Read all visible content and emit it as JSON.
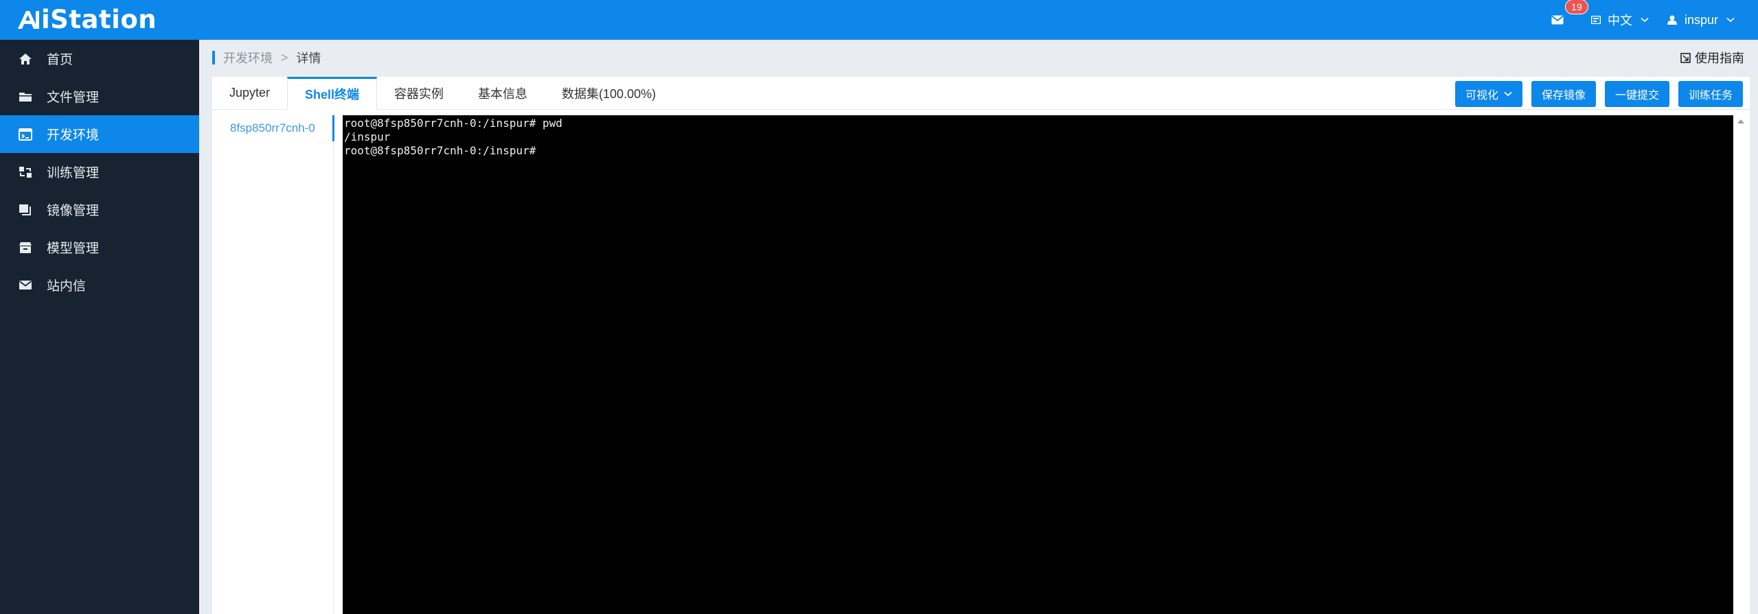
{
  "app": {
    "logo_text": "iStation",
    "logo_mark": "AI"
  },
  "header": {
    "unread_count": "19",
    "language": "中文",
    "username": "inspur"
  },
  "sidebar": {
    "items": [
      {
        "label": "首页",
        "icon": "home-icon"
      },
      {
        "label": "文件管理",
        "icon": "folder-icon"
      },
      {
        "label": "开发环境",
        "icon": "dev-env-icon",
        "active": true
      },
      {
        "label": "训练管理",
        "icon": "training-icon"
      },
      {
        "label": "镜像管理",
        "icon": "image-stack-icon"
      },
      {
        "label": "模型管理",
        "icon": "model-box-icon"
      },
      {
        "label": "站内信",
        "icon": "mail-icon"
      }
    ]
  },
  "breadcrumb": {
    "parent": "开发环境",
    "separator": ">",
    "current": "详情"
  },
  "guide_label": "使用指南",
  "tabs": [
    {
      "label": "Jupyter"
    },
    {
      "label": "Shell终端",
      "active": true
    },
    {
      "label": "容器实例"
    },
    {
      "label": "基本信息"
    },
    {
      "label": "数据集(100.00%)"
    }
  ],
  "actions": {
    "visualize": "可视化",
    "save_image": "保存镜像",
    "one_click_submit": "一键提交",
    "train_task": "训练任务"
  },
  "pods": [
    "8fsp850rr7cnh-0"
  ],
  "terminal": {
    "lines": [
      "root@8fsp850rr7cnh-0:/inspur# pwd",
      "/inspur",
      "root@8fsp850rr7cnh-0:/inspur#"
    ]
  },
  "colors": {
    "brand": "#0d87ea",
    "sidebar_bg": "#172331",
    "badge": "#ef5350",
    "terminal_bg": "#000000"
  }
}
